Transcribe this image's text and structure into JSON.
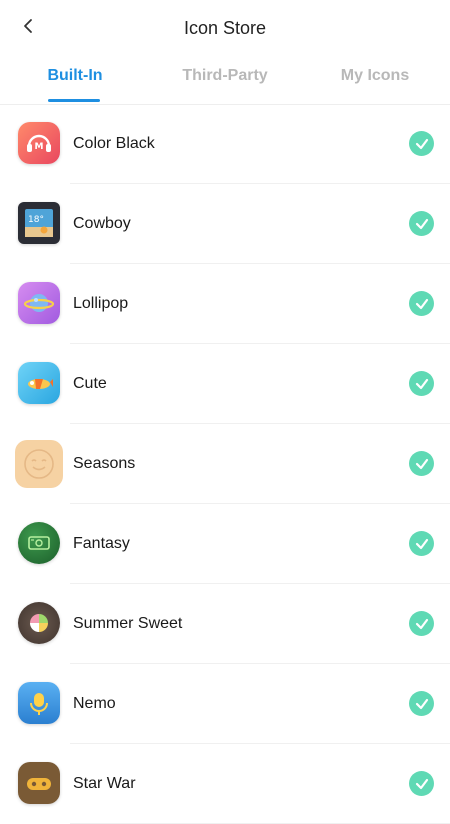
{
  "header": {
    "title": "Icon Store",
    "back_icon": "chevron-left-icon"
  },
  "tabs": [
    {
      "label": "Built-In",
      "active": true
    },
    {
      "label": "Third-Party",
      "active": false
    },
    {
      "label": "My Icons",
      "active": false
    }
  ],
  "colors": {
    "accent": "#1e8fe1",
    "inactive_tab": "#b8b8b8",
    "check": "#5fd9b4"
  },
  "themes": [
    {
      "name": "Color Black",
      "icon": "music-headphones-icon",
      "selected": true
    },
    {
      "name": "Cowboy",
      "icon": "weather-calendar-icon",
      "selected": true
    },
    {
      "name": "Lollipop",
      "icon": "planet-icon",
      "selected": true
    },
    {
      "name": "Cute",
      "icon": "airplane-icon",
      "selected": true
    },
    {
      "name": "Seasons",
      "icon": "app-face-icon",
      "selected": true
    },
    {
      "name": "Fantasy",
      "icon": "green-card-icon",
      "selected": true
    },
    {
      "name": "Summer Sweet",
      "icon": "fruit-slice-icon",
      "selected": true
    },
    {
      "name": "Nemo",
      "icon": "microphone-icon",
      "selected": true
    },
    {
      "name": "Star War",
      "icon": "gamepad-icon",
      "selected": true
    }
  ]
}
